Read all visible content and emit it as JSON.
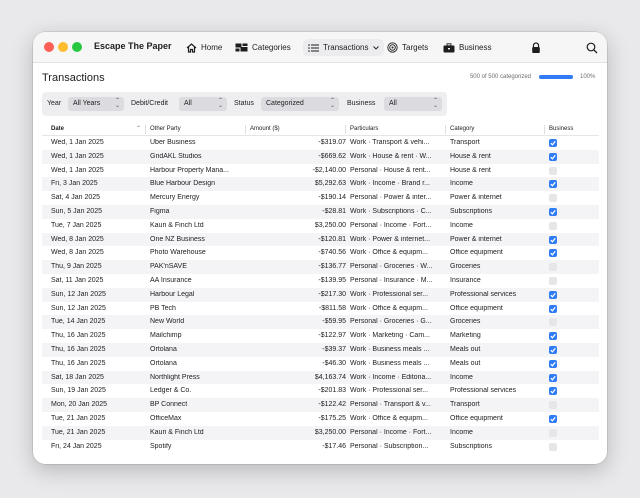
{
  "app": {
    "title": "Escape The Paper"
  },
  "nav": {
    "home": "Home",
    "categories": "Categories",
    "transactions": "Transactions",
    "targets": "Targets",
    "business": "Business"
  },
  "page": {
    "title": "Transactions",
    "categorized_text": "500 of 500 categorized",
    "progress_fraction": 1.0,
    "progress_pct": "100%"
  },
  "filters": {
    "year_label": "Year",
    "year_value": "All Years",
    "debit_credit_label": "Debit/Credit",
    "debit_credit_value": "All",
    "status_label": "Status",
    "status_value": "Categorized",
    "business_label": "Business",
    "business_value": "All"
  },
  "table": {
    "headers": {
      "date": "Date",
      "other_party": "Other Party",
      "amount": "Amount ($)",
      "particulars": "Particulars",
      "category": "Category",
      "business": "Business"
    },
    "rows": [
      {
        "date": "Wed, 1 Jan 2025",
        "party": "Uber Business",
        "amount": "-$319.07",
        "particulars": "Work · Transport & vehi...",
        "category": "Transport",
        "business": true
      },
      {
        "date": "Wed, 1 Jan 2025",
        "party": "GridAKL Studios",
        "amount": "-$669.62",
        "particulars": "Work · House & rent · W...",
        "category": "House & rent",
        "business": true
      },
      {
        "date": "Wed, 1 Jan 2025",
        "party": "Harbour Property Mana...",
        "amount": "-$2,140.00",
        "particulars": "Personal · House & rent...",
        "category": "House & rent",
        "business": false
      },
      {
        "date": "Fri, 3 Jan 2025",
        "party": "Blue Harbour Design",
        "amount": "$5,292.63",
        "particulars": "Work · Income · Brand r...",
        "category": "Income",
        "business": true
      },
      {
        "date": "Sat, 4 Jan 2025",
        "party": "Mercury Energy",
        "amount": "-$190.14",
        "particulars": "Personal · Power & inter...",
        "category": "Power & internet",
        "business": false
      },
      {
        "date": "Sun, 5 Jan 2025",
        "party": "Figma",
        "amount": "-$28.81",
        "particulars": "Work · Subscriptions · C...",
        "category": "Subscriptions",
        "business": true
      },
      {
        "date": "Tue, 7 Jan 2025",
        "party": "Kauri & Finch Ltd",
        "amount": "$3,250.00",
        "particulars": "Personal · Income · Fort...",
        "category": "Income",
        "business": false
      },
      {
        "date": "Wed, 8 Jan 2025",
        "party": "One NZ Business",
        "amount": "-$120.81",
        "particulars": "Work · Power & internet...",
        "category": "Power & internet",
        "business": true
      },
      {
        "date": "Wed, 8 Jan 2025",
        "party": "Photo Warehouse",
        "amount": "-$740.56",
        "particulars": "Work · Office & equipm...",
        "category": "Office equipment",
        "business": true
      },
      {
        "date": "Thu, 9 Jan 2025",
        "party": "PAK'nSAVE",
        "amount": "-$136.77",
        "particulars": "Personal · Groceries · W...",
        "category": "Groceries",
        "business": false
      },
      {
        "date": "Sat, 11 Jan 2025",
        "party": "AA Insurance",
        "amount": "-$139.95",
        "particulars": "Personal · Insurance · M...",
        "category": "Insurance",
        "business": false
      },
      {
        "date": "Sun, 12 Jan 2025",
        "party": "Harbour Legal",
        "amount": "-$217.30",
        "particulars": "Work · Professional ser...",
        "category": "Professional services",
        "business": true
      },
      {
        "date": "Sun, 12 Jan 2025",
        "party": "PB Tech",
        "amount": "-$811.58",
        "particulars": "Work · Office & equipm...",
        "category": "Office equipment",
        "business": true
      },
      {
        "date": "Tue, 14 Jan 2025",
        "party": "New World",
        "amount": "-$59.95",
        "particulars": "Personal · Groceries · G...",
        "category": "Groceries",
        "business": false
      },
      {
        "date": "Thu, 16 Jan 2025",
        "party": "Mailchimp",
        "amount": "-$122.97",
        "particulars": "Work · Marketing · Cam...",
        "category": "Marketing",
        "business": true
      },
      {
        "date": "Thu, 16 Jan 2025",
        "party": "Ortolana",
        "amount": "-$39.37",
        "particulars": "Work · Business meals ...",
        "category": "Meals out",
        "business": true
      },
      {
        "date": "Thu, 16 Jan 2025",
        "party": "Ortolana",
        "amount": "-$46.30",
        "particulars": "Work · Business meals ...",
        "category": "Meals out",
        "business": true
      },
      {
        "date": "Sat, 18 Jan 2025",
        "party": "Northlight Press",
        "amount": "$4,163.74",
        "particulars": "Work · Income · Editoria...",
        "category": "Income",
        "business": true
      },
      {
        "date": "Sun, 19 Jan 2025",
        "party": "Ledger & Co.",
        "amount": "-$201.83",
        "particulars": "Work · Professional ser...",
        "category": "Professional services",
        "business": true
      },
      {
        "date": "Mon, 20 Jan 2025",
        "party": "BP Connect",
        "amount": "-$122.42",
        "particulars": "Personal · Transport & v...",
        "category": "Transport",
        "business": false
      },
      {
        "date": "Tue, 21 Jan 2025",
        "party": "OfficeMax",
        "amount": "-$175.25",
        "particulars": "Work · Office & equipm...",
        "category": "Office equipment",
        "business": true
      },
      {
        "date": "Tue, 21 Jan 2025",
        "party": "Kauri & Finch Ltd",
        "amount": "$3,250.00",
        "particulars": "Personal · Income · Fort...",
        "category": "Income",
        "business": false
      },
      {
        "date": "Fri, 24 Jan 2025",
        "party": "Spotify",
        "amount": "-$17.46",
        "particulars": "Personal · Subscription...",
        "category": "Subscriptions",
        "business": false
      }
    ]
  },
  "colors": {
    "accent": "#2f7cf6",
    "close": "#fe5f57",
    "minimize": "#febc2e",
    "zoom": "#28c840"
  },
  "icons": [
    "home-icon",
    "categories-icon",
    "list-icon",
    "target-icon",
    "briefcase-icon",
    "lock-icon",
    "search-icon"
  ]
}
